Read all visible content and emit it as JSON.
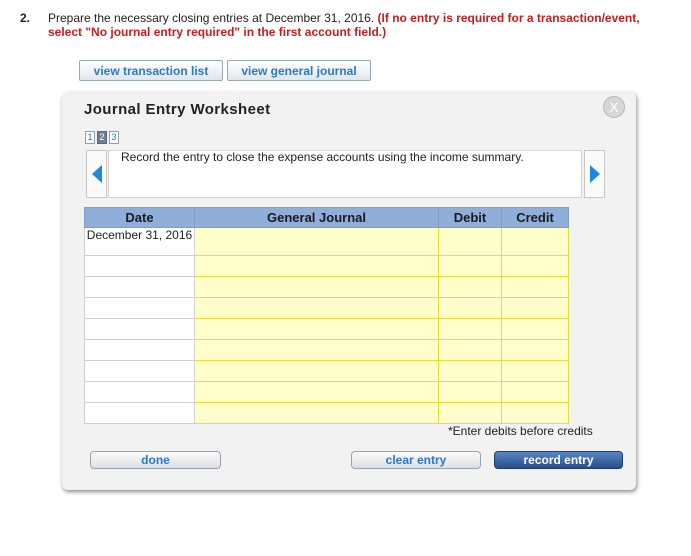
{
  "question": {
    "number": "2.",
    "text": "Prepare the necessary closing entries at December 31, 2016.",
    "note": "(If no entry is required for a transaction/event, select \"No journal entry required\" in the first account field.)"
  },
  "top_buttons": {
    "view_transaction_list": "view transaction list",
    "view_general_journal": "view general journal"
  },
  "worksheet": {
    "title": "Journal Entry Worksheet",
    "close_label": "X",
    "pages": [
      "1",
      "2",
      "3"
    ],
    "active_page": "2",
    "description": "Record the entry to close the expense accounts using the income summary.",
    "columns": {
      "date": "Date",
      "general_journal": "General Journal",
      "debit": "Debit",
      "credit": "Credit"
    },
    "rows": [
      {
        "date": "December 31, 2016",
        "account": "",
        "debit": "",
        "credit": ""
      },
      {
        "date": "",
        "account": "",
        "debit": "",
        "credit": ""
      },
      {
        "date": "",
        "account": "",
        "debit": "",
        "credit": ""
      },
      {
        "date": "",
        "account": "",
        "debit": "",
        "credit": ""
      },
      {
        "date": "",
        "account": "",
        "debit": "",
        "credit": ""
      },
      {
        "date": "",
        "account": "",
        "debit": "",
        "credit": ""
      },
      {
        "date": "",
        "account": "",
        "debit": "",
        "credit": ""
      },
      {
        "date": "",
        "account": "",
        "debit": "",
        "credit": ""
      },
      {
        "date": "",
        "account": "",
        "debit": "",
        "credit": ""
      }
    ],
    "hint": "*Enter debits before credits",
    "buttons": {
      "done": "done",
      "clear_entry": "clear entry",
      "record_entry": "record entry"
    }
  },
  "colors": {
    "note_red": "#cc1b1b",
    "link_blue": "#2a78c8",
    "header_blue": "#90aeda",
    "input_yellow": "#ffffcc",
    "arrow_blue": "#1a8be0",
    "record_button": "#264e8a"
  },
  "icons": {
    "prev": "arrow-left-icon",
    "next": "arrow-right-icon",
    "close": "close-icon"
  }
}
